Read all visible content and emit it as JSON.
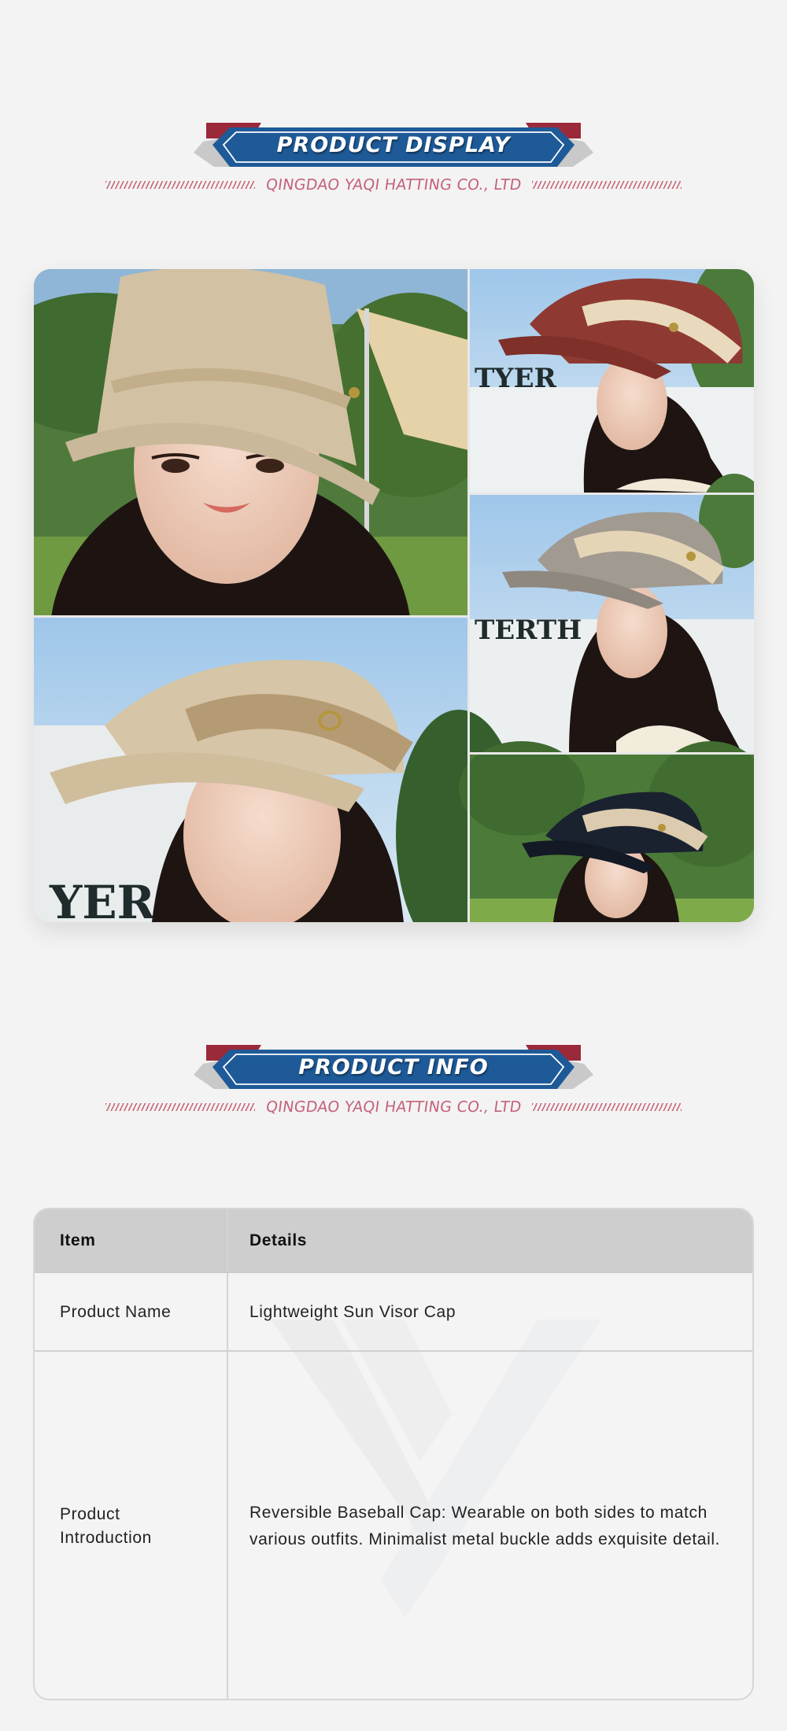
{
  "display_section": {
    "title": "PRODUCT DISPLAY",
    "company": "QINGDAO YAQI HATTING CO., LTD"
  },
  "gallery": {
    "photos": [
      {
        "name": "khaki-bucket-hat-front",
        "hat_color": "#cdbd9f"
      },
      {
        "name": "red-visor-cap-profile",
        "hat_color": "#8e3a33"
      },
      {
        "name": "gray-visor-cap-profile",
        "hat_color": "#a19a91"
      },
      {
        "name": "beige-visor-cap-profile",
        "hat_color": "#d6c5a6"
      },
      {
        "name": "navy-visor-cap-profile",
        "hat_color": "#1a2230"
      }
    ]
  },
  "info_section": {
    "title": "PRODUCT INFO",
    "company": "QINGDAO YAQI HATTING CO., LTD"
  },
  "table": {
    "headers": {
      "item": "Item",
      "details": "Details"
    },
    "rows": [
      {
        "item": "Product Name",
        "details": "Lightweight Sun Visor Cap"
      },
      {
        "item": "Product Introduction",
        "details": "Reversible Baseball Cap: Wearable on both sides to match various outfits. Minimalist metal buckle adds exquisite detail."
      }
    ]
  },
  "colors": {
    "banner_blue": "#1e5a98",
    "banner_red": "#9a2a3a",
    "company_pink": "#c4627a",
    "table_header": "#cecece"
  }
}
